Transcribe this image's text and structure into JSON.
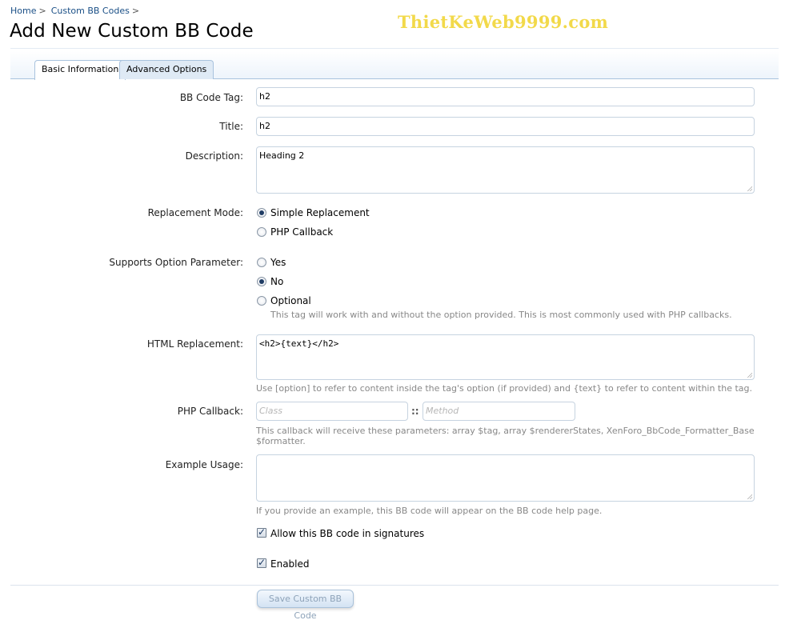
{
  "breadcrumb": {
    "items": [
      "Home",
      "Custom BB Codes"
    ],
    "separator": ">"
  },
  "page": {
    "title": "Add New Custom BB Code"
  },
  "watermark": {
    "text": "ThietKeWeb9999.com",
    "color": "#f2d94a"
  },
  "tabs": [
    {
      "label": "Basic Information",
      "active": true
    },
    {
      "label": "Advanced Options",
      "active": false
    }
  ],
  "form": {
    "bb_code_tag": {
      "label": "BB Code Tag:",
      "value": "h2"
    },
    "title": {
      "label": "Title:",
      "value": "h2"
    },
    "description": {
      "label": "Description:",
      "value": "Heading 2"
    },
    "replacement_mode": {
      "label": "Replacement Mode:",
      "options": [
        {
          "label": "Simple Replacement",
          "selected": true
        },
        {
          "label": "PHP Callback",
          "selected": false
        }
      ]
    },
    "supports_option": {
      "label": "Supports Option Parameter:",
      "options": [
        {
          "label": "Yes",
          "selected": false
        },
        {
          "label": "No",
          "selected": true
        },
        {
          "label": "Optional",
          "selected": false
        }
      ],
      "hint": "This tag will work with and without the option provided. This is most commonly used with PHP callbacks."
    },
    "html_replacement": {
      "label": "HTML Replacement:",
      "value": "<h2>{text}</h2>",
      "hint": "Use [option] to refer to content inside the tag's option (if provided) and {text} to refer to content within the tag."
    },
    "php_callback": {
      "label": "PHP Callback:",
      "class_placeholder": "Class",
      "separator": "::",
      "method_placeholder": "Method",
      "hint_line1": "This callback will receive these parameters: array $tag, array $rendererStates, XenForo_BbCode_Formatter_Base",
      "hint_line2": "$formatter."
    },
    "example_usage": {
      "label": "Example Usage:",
      "value": "",
      "hint": "If you provide an example, this BB code will appear on the BB code help page."
    },
    "allow_signatures": {
      "label": "Allow this BB code in signatures",
      "checked": true
    },
    "enabled": {
      "label": "Enabled",
      "checked": true
    }
  },
  "actions": {
    "save_label": "Save Custom BB Code"
  }
}
